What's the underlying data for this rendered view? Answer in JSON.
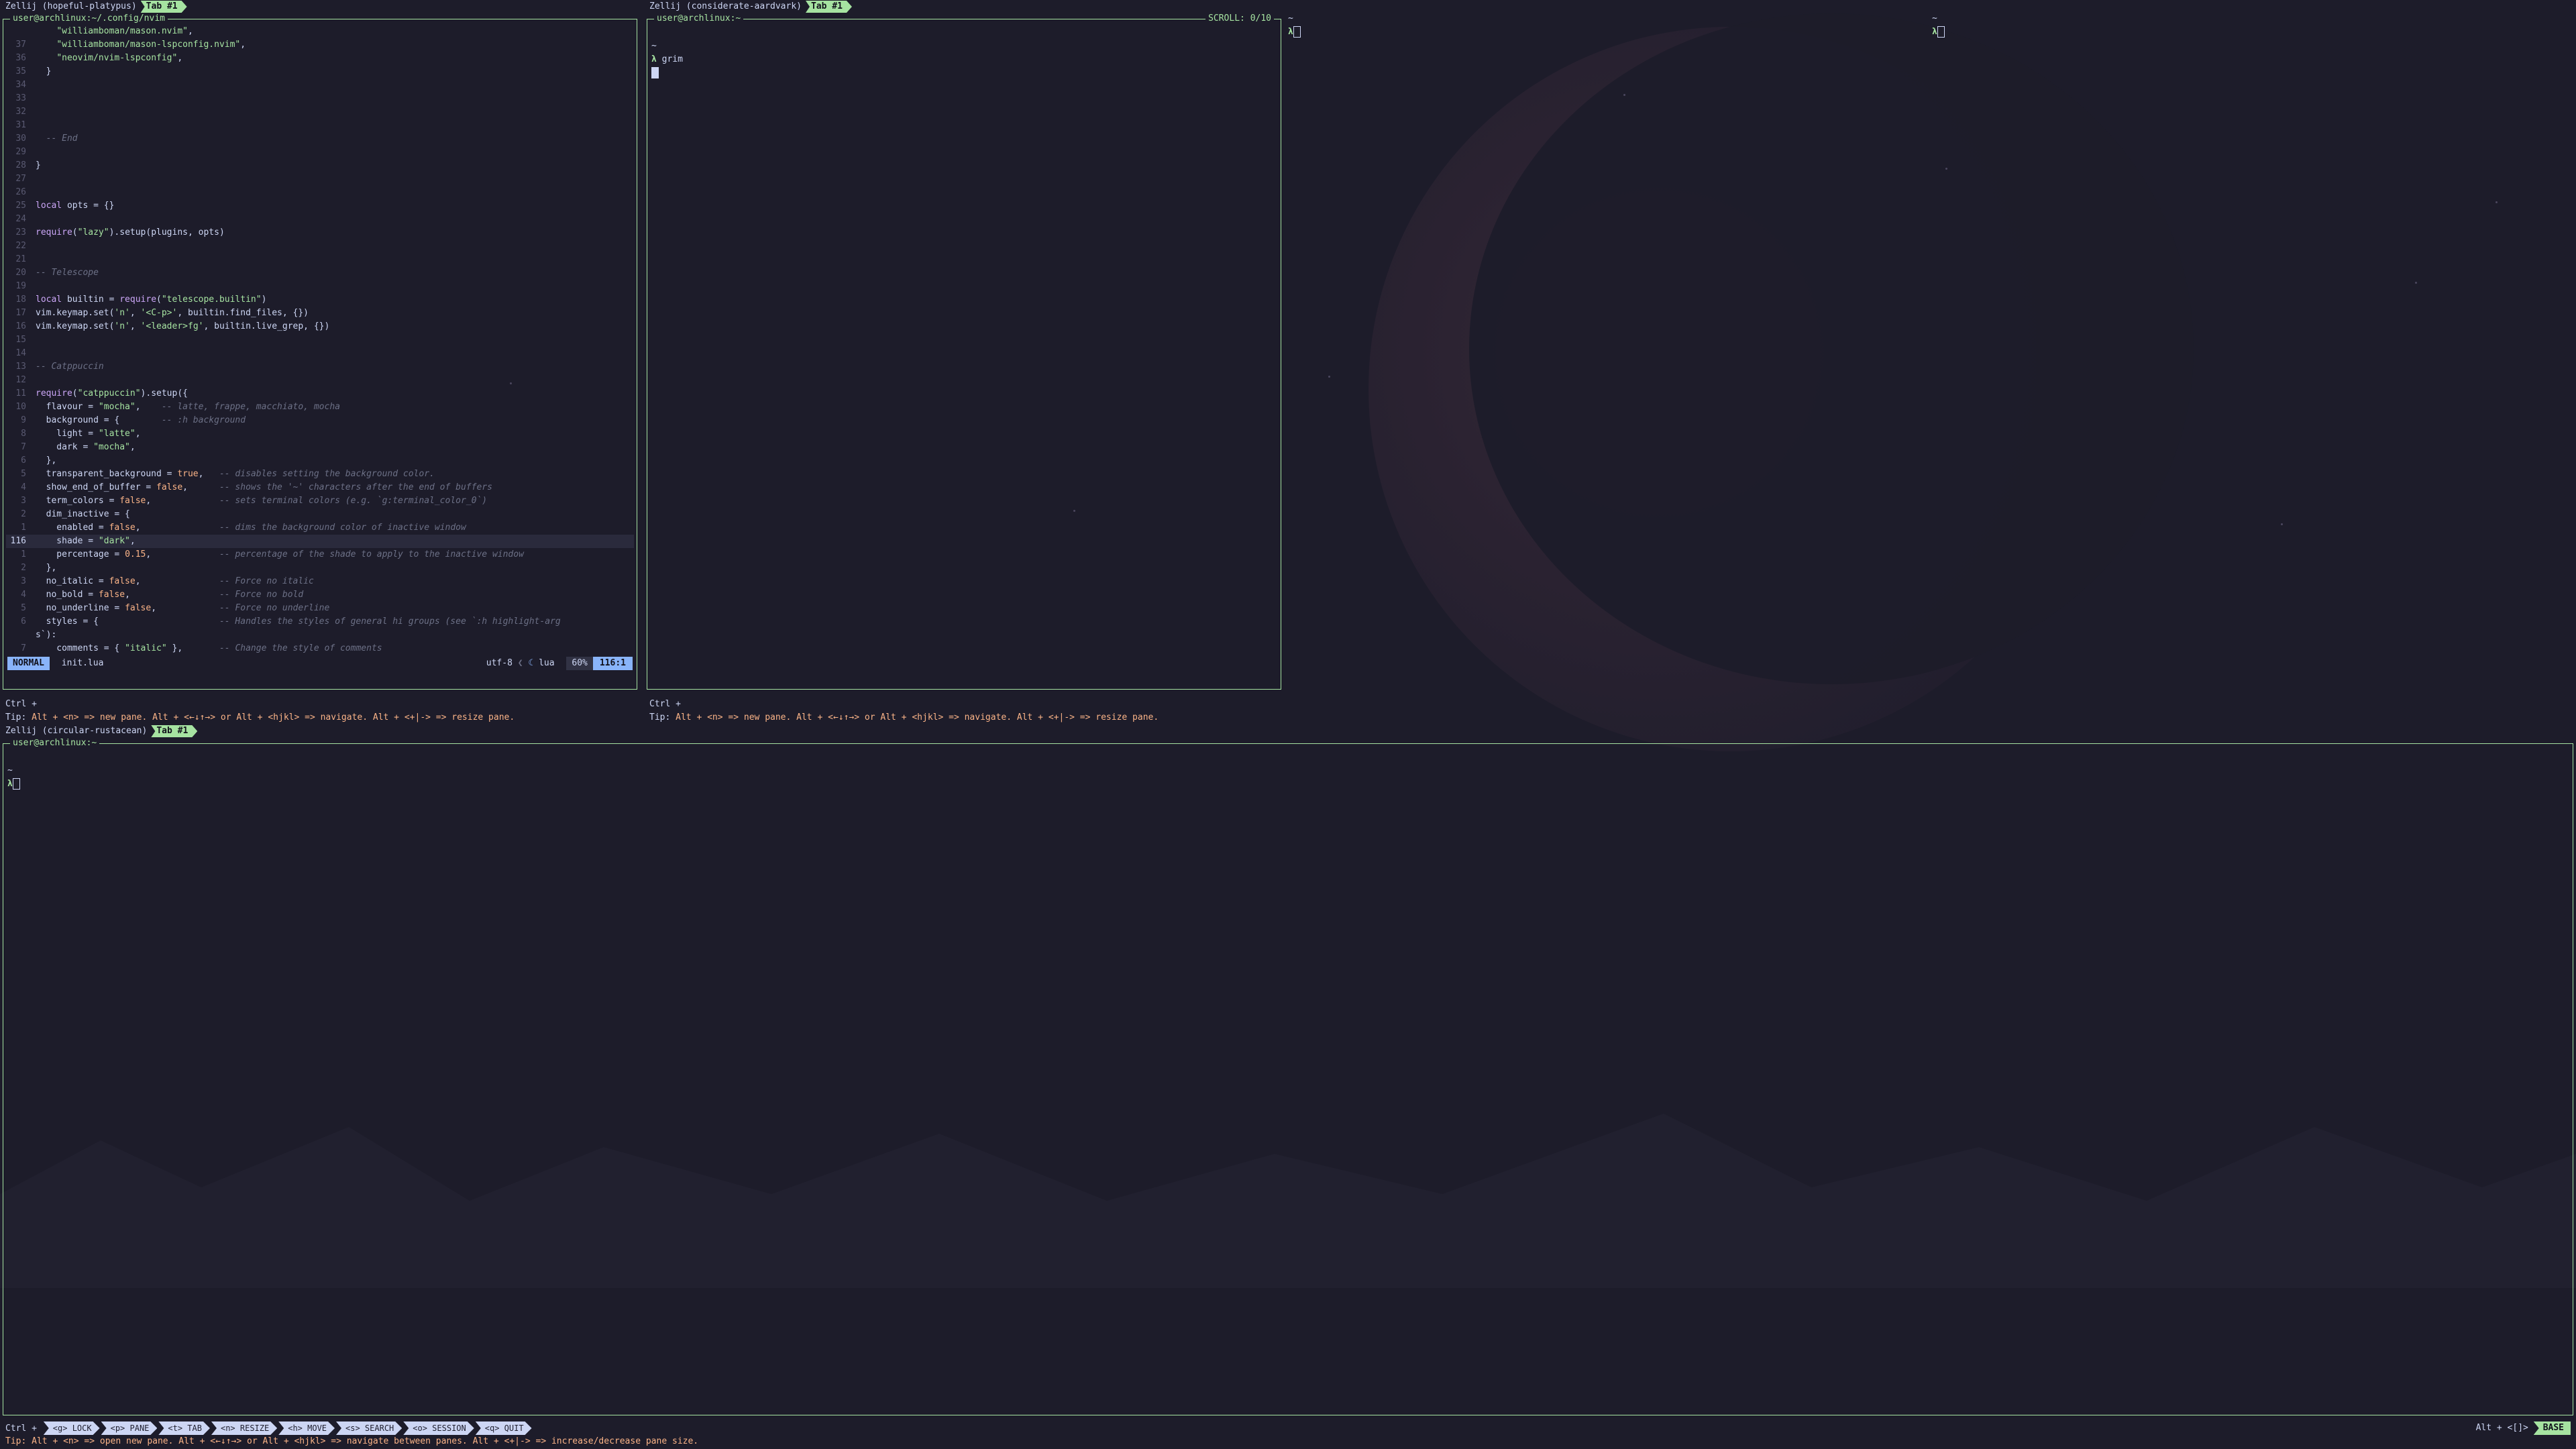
{
  "sessions": {
    "top_left": {
      "name": "Zellij (hopeful-platypus)",
      "tab": "Tab #1"
    },
    "top_right": {
      "name": "Zellij (considerate-aardvark)",
      "tab": "Tab #1"
    },
    "bottom": {
      "name": "Zellij (circular-rustacean)",
      "tab": "Tab #1"
    }
  },
  "nvim_pane": {
    "title": "user@archlinux:~/.config/nvim",
    "lines": [
      {
        "n": "",
        "t": "    \"williamboman/mason.nvim\","
      },
      {
        "n": "37",
        "t": "    \"williamboman/mason-lspconfig.nvim\","
      },
      {
        "n": "36",
        "t": "    \"neovim/nvim-lspconfig\","
      },
      {
        "n": "35",
        "t": "  }"
      },
      {
        "n": "34",
        "t": ""
      },
      {
        "n": "33",
        "t": ""
      },
      {
        "n": "32",
        "t": ""
      },
      {
        "n": "31",
        "t": ""
      },
      {
        "n": "30",
        "t": "  -- End"
      },
      {
        "n": "29",
        "t": ""
      },
      {
        "n": "28",
        "t": "}"
      },
      {
        "n": "27",
        "t": ""
      },
      {
        "n": "26",
        "t": ""
      },
      {
        "n": "25",
        "t": "local opts = {}"
      },
      {
        "n": "24",
        "t": ""
      },
      {
        "n": "23",
        "t": "require(\"lazy\").setup(plugins, opts)"
      },
      {
        "n": "22",
        "t": ""
      },
      {
        "n": "21",
        "t": ""
      },
      {
        "n": "20",
        "t": "-- Telescope"
      },
      {
        "n": "19",
        "t": ""
      },
      {
        "n": "18",
        "t": "local builtin = require(\"telescope.builtin\")"
      },
      {
        "n": "17",
        "t": "vim.keymap.set('n', '<C-p>', builtin.find_files, {})"
      },
      {
        "n": "16",
        "t": "vim.keymap.set('n', '<leader>fg', builtin.live_grep, {})"
      },
      {
        "n": "15",
        "t": ""
      },
      {
        "n": "14",
        "t": ""
      },
      {
        "n": "13",
        "t": "-- Catppuccin"
      },
      {
        "n": "12",
        "t": ""
      },
      {
        "n": "11",
        "t": "require(\"catppuccin\").setup({"
      },
      {
        "n": "10",
        "t": "  flavour = \"mocha\",    -- latte, frappe, macchiato, mocha"
      },
      {
        "n": "9",
        "t": "  background = {        -- :h background"
      },
      {
        "n": "8",
        "t": "    light = \"latte\","
      },
      {
        "n": "7",
        "t": "    dark = \"mocha\","
      },
      {
        "n": "6",
        "t": "  },"
      },
      {
        "n": "5",
        "t": "  transparent_background = true,   -- disables setting the background color."
      },
      {
        "n": "4",
        "t": "  show_end_of_buffer = false,      -- shows the '~' characters after the end of buffers"
      },
      {
        "n": "3",
        "t": "  term_colors = false,             -- sets terminal colors (e.g. `g:terminal_color_0`)"
      },
      {
        "n": "2",
        "t": "  dim_inactive = {"
      },
      {
        "n": "1",
        "t": "    enabled = false,               -- dims the background color of inactive window"
      },
      {
        "n": "116",
        "t": "    shade = \"dark\","
      },
      {
        "n": "1",
        "t": "    percentage = 0.15,             -- percentage of the shade to apply to the inactive window"
      },
      {
        "n": "2",
        "t": "  },"
      },
      {
        "n": "3",
        "t": "  no_italic = false,               -- Force no italic"
      },
      {
        "n": "4",
        "t": "  no_bold = false,                 -- Force no bold"
      },
      {
        "n": "5",
        "t": "  no_underline = false,            -- Force no underline"
      },
      {
        "n": "6",
        "t": "  styles = {                       -- Handles the styles of general hi groups (see `:h highlight-arg"
      },
      {
        "n": "",
        "t": "s`):"
      },
      {
        "n": "7",
        "t": "    comments = { \"italic\" },       -- Change the style of comments"
      }
    ],
    "status": {
      "mode": "NORMAL",
      "file": "init.lua",
      "encoding": "utf-8",
      "filetype": "lua",
      "percent": "60%",
      "position": "116:1"
    }
  },
  "grim_pane": {
    "title": "user@archlinux:~",
    "scroll": "SCROLL:  0/10",
    "lines": [
      "~",
      "grim"
    ]
  },
  "right_prompts": {
    "tilde": "~"
  },
  "bottom_pane": {
    "title": "user@archlinux:~",
    "lines": [
      "~"
    ]
  },
  "top_bar": {
    "ctrl": "Ctrl +"
  },
  "top_tip": {
    "prefix": "Tip: ",
    "text": "Alt + <n> => new pane. Alt + <←↓↑→> or Alt + <hjkl> => navigate. Alt + <+|-> => resize pane."
  },
  "bottom_bar": {
    "ctrl": "Ctrl +",
    "items": [
      "<g> LOCK",
      "<p> PANE",
      "<t> TAB",
      "<n> RESIZE",
      "<h> MOVE",
      "<s> SEARCH",
      "<o> SESSION",
      "<q> QUIT"
    ],
    "right_hint": "Alt + <[]>",
    "mode": "BASE"
  },
  "bottom_tip": {
    "text": "Tip: Alt + <n> => open new pane. Alt + <←↓↑→> or Alt + <hjkl> => navigate between panes. Alt + <+|-> => increase/decrease pane size."
  },
  "colors": {
    "accent": "#a6e3a1",
    "blue": "#89b4fa",
    "bg": "#1d1c2a",
    "text": "#cdd6f4"
  }
}
